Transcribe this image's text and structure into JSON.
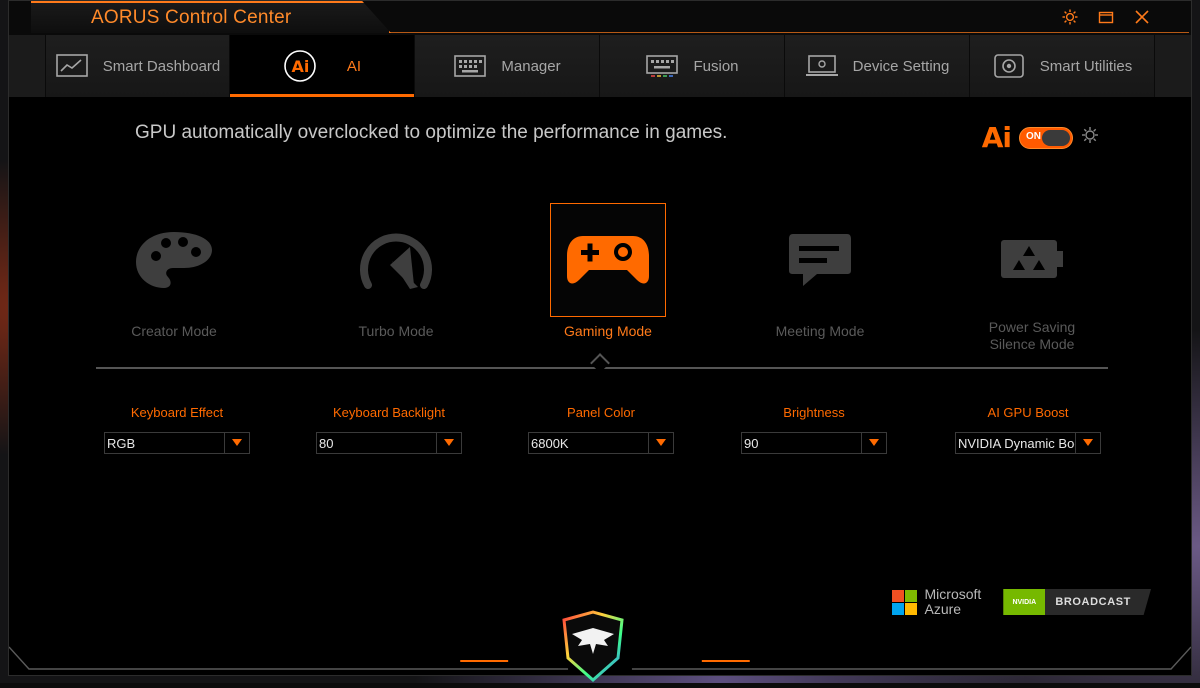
{
  "window": {
    "title": "AORUS Control Center",
    "controls": [
      {
        "name": "settings-icon"
      },
      {
        "name": "restore-icon"
      },
      {
        "name": "close-icon"
      }
    ]
  },
  "tabs": [
    {
      "label": "Smart Dashboard",
      "icon": "dashboard-icon",
      "active": false
    },
    {
      "label": "AI",
      "icon": "ai-icon",
      "active": true
    },
    {
      "label": "Manager",
      "icon": "keyboard-manager-icon",
      "active": false
    },
    {
      "label": "Fusion",
      "icon": "rgb-keyboard-icon",
      "active": false
    },
    {
      "label": "Device Setting",
      "icon": "laptop-icon",
      "active": false
    },
    {
      "label": "Smart Utilities",
      "icon": "utilities-icon",
      "active": false
    }
  ],
  "ai": {
    "headline": "GPU automatically overclocked to optimize the performance in games.",
    "toggle_logo": "Ai",
    "toggle_state": "ON",
    "modes": [
      {
        "label": "Creator Mode",
        "icon": "palette-icon",
        "active": false
      },
      {
        "label": "Turbo Mode",
        "icon": "speedometer-icon",
        "active": false
      },
      {
        "label": "Gaming Mode",
        "icon": "gamepad-icon",
        "active": true
      },
      {
        "label": "Meeting Mode",
        "icon": "chat-icon",
        "active": false
      },
      {
        "label_line1": "Power Saving",
        "label_line2": "Silence Mode",
        "icon": "battery-recycle-icon",
        "active": false
      }
    ],
    "settings": [
      {
        "label": "Keyboard Effect",
        "value": "RGB"
      },
      {
        "label": "Keyboard Backlight",
        "value": "80"
      },
      {
        "label": "Panel Color",
        "value": "6800K"
      },
      {
        "label": "Brightness",
        "value": "90"
      },
      {
        "label": "AI GPU Boost",
        "value": "NVIDIA Dynamic Boost"
      }
    ]
  },
  "partners": {
    "microsoft_line1": "Microsoft",
    "microsoft_line2": "Azure",
    "nvidia_badge": "NVIDIA",
    "nvidia_label": "BROADCAST"
  },
  "colors": {
    "accent": "#ff6a00",
    "inactive_text": "#5a5a5a",
    "tab_bg": "#1b1b1b"
  }
}
